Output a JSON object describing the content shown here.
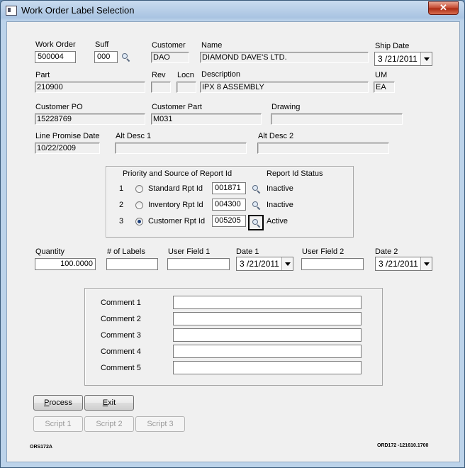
{
  "window": {
    "title": "Work Order Label Selection",
    "close_glyph": "✕"
  },
  "header": {
    "work_order_label": "Work Order",
    "work_order_value": "500004",
    "suff_label": "Suff",
    "suff_value": "000",
    "customer_label": "Customer",
    "customer_value": "DAO",
    "name_label": "Name",
    "name_value": "DIAMOND DAVE'S LTD.",
    "ship_date_label": "Ship Date",
    "ship_date_value": "3 /21/2011",
    "part_label": "Part",
    "part_value": "210900",
    "rev_label": "Rev",
    "rev_value": "",
    "locn_label": "Locn",
    "locn_value": "",
    "description_label": "Description",
    "description_value": "IPX 8 ASSEMBLY",
    "um_label": "UM",
    "um_value": "EA",
    "customer_po_label": "Customer PO",
    "customer_po_value": "15228769",
    "customer_part_label": "Customer Part",
    "customer_part_value": "M031",
    "drawing_label": "Drawing",
    "drawing_value": "",
    "line_promise_label": "Line Promise Date",
    "line_promise_value": "10/22/2009",
    "alt_desc1_label": "Alt Desc 1",
    "alt_desc1_value": "",
    "alt_desc2_label": "Alt Desc 2",
    "alt_desc2_value": ""
  },
  "report": {
    "priority_header": "Priority and Source of Report Id",
    "status_header": "Report Id Status",
    "rows": [
      {
        "num": "1",
        "label": "Standard Rpt Id",
        "value": "001871",
        "status": "Inactive",
        "checked": false
      },
      {
        "num": "2",
        "label": "Inventory Rpt Id",
        "value": "004300",
        "status": "Inactive",
        "checked": false
      },
      {
        "num": "3",
        "label": "Customer Rpt Id",
        "value": "005205",
        "status": "Active",
        "checked": true
      }
    ]
  },
  "quantity_row": {
    "quantity_label": "Quantity",
    "quantity_value": "100.0000",
    "labels_label": "# of Labels",
    "labels_value": "",
    "user1_label": "User Field 1",
    "user1_value": "",
    "date1_label": "Date 1",
    "date1_value": "3 /21/2011",
    "user2_label": "User Field 2",
    "user2_value": "",
    "date2_label": "Date 2",
    "date2_value": "3 /21/2011"
  },
  "comments": {
    "labels": [
      "Comment 1",
      "Comment 2",
      "Comment 3",
      "Comment 4",
      "Comment 5"
    ],
    "values": [
      "",
      "",
      "",
      "",
      ""
    ]
  },
  "buttons": {
    "process": "Process",
    "exit": "Exit",
    "script1": "Script 1",
    "script2": "Script 2",
    "script3": "Script 3"
  },
  "footer": {
    "left_code": "ORS172A",
    "right_code": "ORD172 -121610.1700"
  }
}
